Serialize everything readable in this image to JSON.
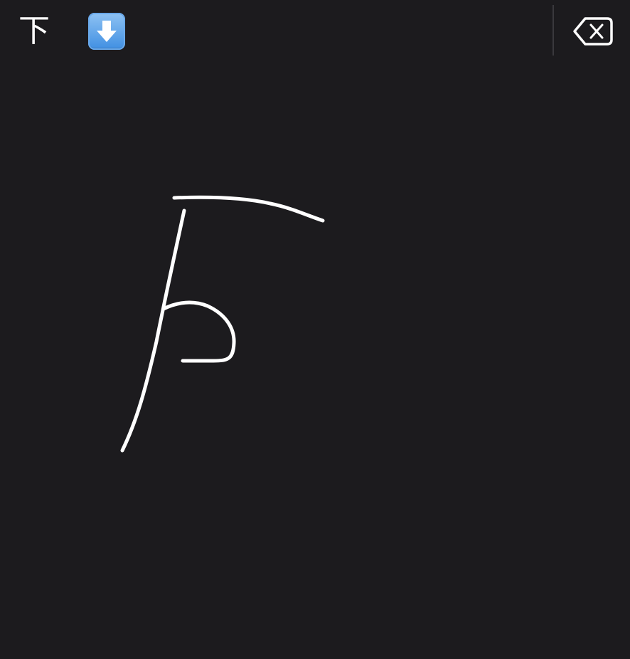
{
  "candidates": [
    {
      "type": "character",
      "text": "下"
    },
    {
      "type": "emoji",
      "icon": "down-arrow-emoji-icon"
    }
  ],
  "delete_key": {
    "icon": "backspace-icon"
  },
  "colors": {
    "background": "#1c1b1e",
    "stroke": "#ffffff",
    "divider": "#3a393d",
    "emoji_fill": "#4a96e6"
  },
  "canvas": {
    "strokes_count": 3
  }
}
